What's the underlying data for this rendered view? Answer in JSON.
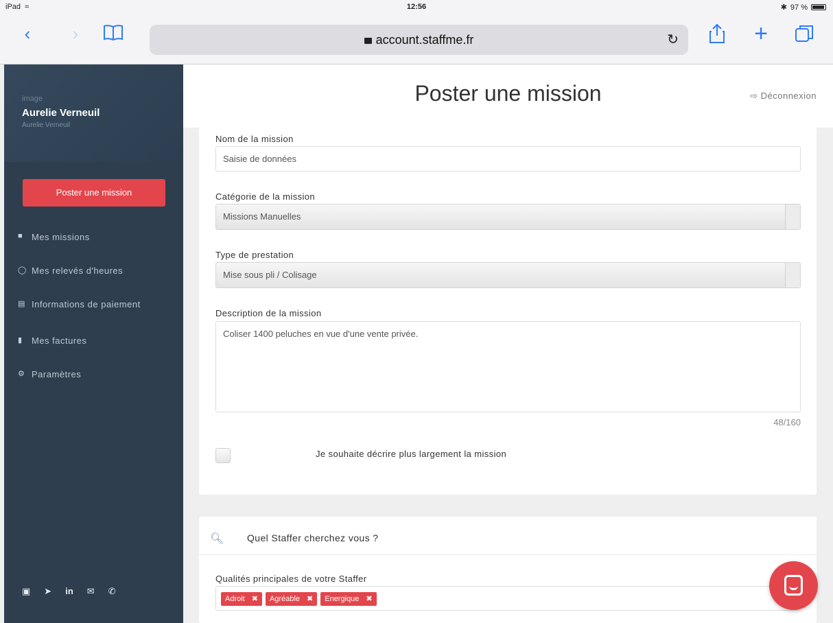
{
  "status_bar": {
    "device": "iPad",
    "time": "12:56",
    "battery": "97 %"
  },
  "browser": {
    "url": "account.staffme.fr"
  },
  "sidebar": {
    "image_alt": "image",
    "user_name": "Aurelie Verneuil",
    "user_sub": "Aurelie Verneuil",
    "post_button": "Poster une mission",
    "items": [
      {
        "label": "Mes missions"
      },
      {
        "label": "Mes relevés d'heures"
      },
      {
        "label": "Informations de paiement"
      },
      {
        "label": "Mes factures"
      },
      {
        "label": "Paramètres"
      }
    ],
    "socials": [
      "f",
      "t",
      "in",
      "mail",
      "phone"
    ]
  },
  "header": {
    "title": "Poster une mission",
    "logout": "Déconnexion"
  },
  "form": {
    "name_label": "Nom de la mission",
    "name_value": "Saisie de données",
    "category_label": "Catégorie de la mission",
    "category_value": "Missions Manuelles",
    "type_label": "Type de prestation",
    "type_value": "Mise sous pli / Colisage",
    "description_label": "Description de la mission",
    "description_value": "Coliser 1400 peluches en vue d'une vente privée.",
    "counter": "48/160",
    "checkbox_label": "Je souhaite décrire plus largement la mission"
  },
  "staffer": {
    "section_title": "Quel Staffer cherchez vous ?",
    "qualities_label": "Qualités principales de votre Staffer",
    "tags": [
      "Adroit",
      "Agréable",
      "Energique"
    ]
  }
}
